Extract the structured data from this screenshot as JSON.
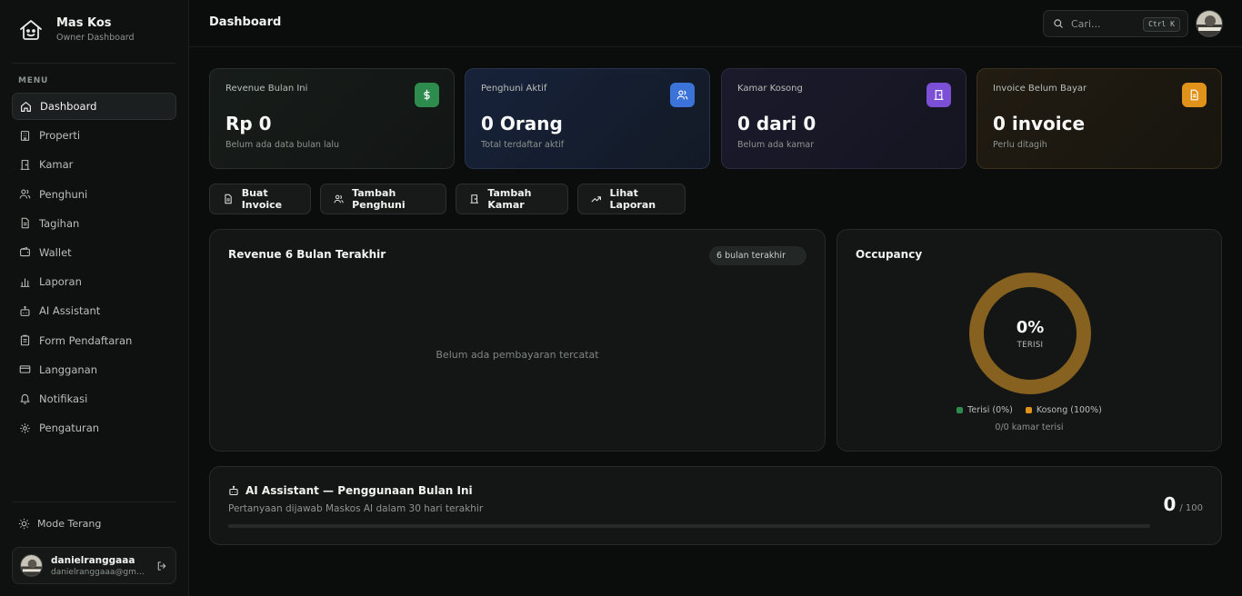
{
  "app": {
    "name": "Mas Kos",
    "subtitle": "Owner Dashboard"
  },
  "sidebar": {
    "menu_label": "MENU",
    "items": [
      {
        "label": "Dashboard",
        "icon": "home-icon",
        "active": true
      },
      {
        "label": "Properti",
        "icon": "building-icon"
      },
      {
        "label": "Kamar",
        "icon": "door-icon"
      },
      {
        "label": "Penghuni",
        "icon": "users-icon"
      },
      {
        "label": "Tagihan",
        "icon": "file-icon"
      },
      {
        "label": "Wallet",
        "icon": "wallet-icon"
      },
      {
        "label": "Laporan",
        "icon": "bar-chart-icon"
      },
      {
        "label": "AI Assistant",
        "icon": "bot-icon"
      },
      {
        "label": "Form Pendaftaran",
        "icon": "clipboard-icon"
      },
      {
        "label": "Langganan",
        "icon": "credit-card-icon"
      },
      {
        "label": "Notifikasi",
        "icon": "bell-icon"
      },
      {
        "label": "Pengaturan",
        "icon": "settings-icon"
      }
    ],
    "mode_label": "Mode Terang",
    "user": {
      "name": "danielranggaaa",
      "email": "danielranggaaa@gmail.com"
    }
  },
  "header": {
    "title": "Dashboard",
    "search_placeholder": "Cari...",
    "shortcut": "Ctrl K"
  },
  "stats": [
    {
      "label": "Revenue Bulan Ini",
      "value": "Rp 0",
      "sub": "Belum ada data bulan lalu",
      "icon": "dollar-icon",
      "color": "#2e8b4e"
    },
    {
      "label": "Penghuni Aktif",
      "value": "0 Orang",
      "sub": "Total terdaftar aktif",
      "icon": "users-icon",
      "color": "#3b73d9"
    },
    {
      "label": "Kamar Kosong",
      "value": "0 dari 0",
      "sub": "Belum ada kamar",
      "icon": "door-icon",
      "color": "#7b4fd6"
    },
    {
      "label": "Invoice Belum Bayar",
      "value": "0 invoice",
      "sub": "Perlu ditagih",
      "icon": "file-icon",
      "color": "#e0921a"
    }
  ],
  "actions": [
    {
      "label": "Buat Invoice",
      "icon": "file-icon"
    },
    {
      "label": "Tambah Penghuni",
      "icon": "users-icon"
    },
    {
      "label": "Tambah Kamar",
      "icon": "door-icon"
    },
    {
      "label": "Lihat Laporan",
      "icon": "trending-up-icon"
    }
  ],
  "revenue_panel": {
    "title": "Revenue 6 Bulan Terakhir",
    "range": "6 bulan terakhir",
    "empty": "Belum ada pembayaran tercatat"
  },
  "occupancy": {
    "title": "Occupancy",
    "percent_text": "0%",
    "center_label": "TERISI",
    "occupied_fraction": 0,
    "legend": [
      {
        "label": "Terisi (0%)",
        "color": "#2e8b4e"
      },
      {
        "label": "Kosong (100%)",
        "color": "#e0921a"
      }
    ],
    "footer": "0/0 kamar terisi"
  },
  "ai_usage": {
    "title": "AI Assistant — Penggunaan Bulan Ini",
    "subtitle": "Pertanyaan dijawab Maskos AI dalam 30 hari terakhir",
    "used": "0",
    "limit": "/ 100",
    "used_fraction": 0
  }
}
